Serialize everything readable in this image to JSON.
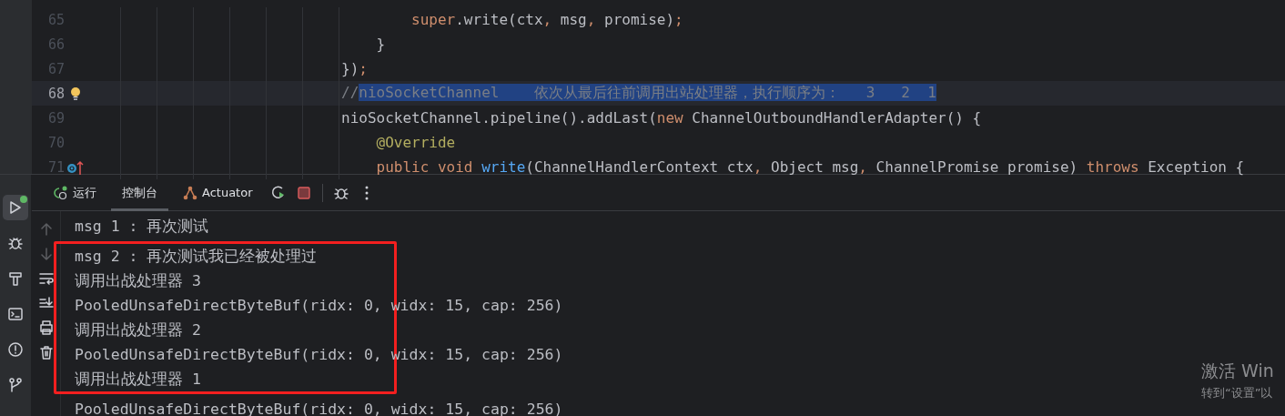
{
  "editor": {
    "lines": [
      {
        "number": "65",
        "current": false,
        "kind": "plain",
        "tokens": [
          {
            "text": "        super",
            "kind": "keyword",
            "selected": false
          },
          {
            "text": ".write(ctx",
            "kind": "plain",
            "selected": false
          },
          {
            "text": ", ",
            "kind": "keyword",
            "selected": false
          },
          {
            "text": "msg",
            "kind": "plain",
            "selected": false
          },
          {
            "text": ", ",
            "kind": "keyword",
            "selected": false
          },
          {
            "text": "promise)",
            "kind": "plain",
            "selected": false
          },
          {
            "text": ";",
            "kind": "keyword",
            "selected": false
          }
        ]
      },
      {
        "number": "66",
        "current": false,
        "kind": "plain",
        "tokens": [
          {
            "text": "    }",
            "kind": "plain",
            "selected": false
          }
        ]
      },
      {
        "number": "67",
        "current": false,
        "kind": "plain",
        "tokens": [
          {
            "text": "})",
            "kind": "plain",
            "selected": false
          },
          {
            "text": ";",
            "kind": "keyword",
            "selected": false
          }
        ]
      },
      {
        "number": "68",
        "current": true,
        "kind": "bulb",
        "tokens": [
          {
            "text": "//",
            "kind": "comment",
            "selected": false
          },
          {
            "text": "nioSocketChannel    依次从最后往前调用出站处理器，执行顺序为：   3   2  1",
            "kind": "comment",
            "selected": true
          }
        ]
      },
      {
        "number": "69",
        "current": false,
        "kind": "plain",
        "tokens": [
          {
            "text": "nioSocketChannel.pipeline().addLast(",
            "kind": "plain",
            "selected": false
          },
          {
            "text": "new ",
            "kind": "keyword",
            "selected": false
          },
          {
            "text": "ChannelOutboundHandlerAdapter() {",
            "kind": "plain",
            "selected": false
          }
        ]
      },
      {
        "number": "70",
        "current": false,
        "kind": "plain",
        "tokens": [
          {
            "text": "    @Override",
            "kind": "annotation",
            "selected": false
          }
        ]
      },
      {
        "number": "71",
        "current": false,
        "kind": "override",
        "tokens": [
          {
            "text": "    public void ",
            "kind": "keyword",
            "selected": false
          },
          {
            "text": "write",
            "kind": "method",
            "selected": false
          },
          {
            "text": "(ChannelHandlerContext ctx",
            "kind": "plain",
            "selected": false
          },
          {
            "text": ", ",
            "kind": "keyword",
            "selected": false
          },
          {
            "text": "Object msg",
            "kind": "plain",
            "selected": false
          },
          {
            "text": ", ",
            "kind": "keyword",
            "selected": false
          },
          {
            "text": "ChannelPromise promise) ",
            "kind": "plain",
            "selected": false
          },
          {
            "text": "throws ",
            "kind": "keyword",
            "selected": false
          },
          {
            "text": "Exception {",
            "kind": "plain",
            "selected": false
          }
        ]
      }
    ]
  },
  "activity_bar": [
    {
      "kind": "run",
      "selected": true
    },
    {
      "kind": "debug",
      "selected": false
    },
    {
      "kind": "build",
      "selected": false
    },
    {
      "kind": "terminal",
      "selected": false
    },
    {
      "kind": "problems",
      "selected": false
    },
    {
      "kind": "git",
      "selected": false
    }
  ],
  "tabs": [
    {
      "label": "运行",
      "kind": "run",
      "selected": false
    },
    {
      "label": "控制台",
      "kind": "plain",
      "selected": true
    },
    {
      "label": "Actuator",
      "kind": "actuator",
      "selected": false
    }
  ],
  "console_tools": [
    {
      "kind": "up",
      "disabled": true
    },
    {
      "kind": "down",
      "disabled": true
    },
    {
      "kind": "wrap",
      "disabled": false
    },
    {
      "kind": "scroll",
      "disabled": false
    },
    {
      "kind": "print",
      "disabled": false
    },
    {
      "kind": "trash",
      "disabled": false
    }
  ],
  "console": {
    "blocks": [
      {
        "framed": false,
        "lines": [
          "msg 1 : 再次测试"
        ]
      },
      {
        "framed": true,
        "lines": [
          "msg 2 : 再次测试我已经被处理过",
          "调用出战处理器 3",
          "PooledUnsafeDirectByteBuf(ridx: 0, widx: 15, cap: 256)",
          "调用出战处理器 2",
          "PooledUnsafeDirectByteBuf(ridx: 0, widx: 15, cap: 256)",
          "调用出战处理器 1"
        ]
      },
      {
        "framed": false,
        "lines": [
          "PooledUnsafeDirectByteBuf(ridx: 0, widx: 15, cap: 256)"
        ]
      }
    ]
  },
  "activation_notice": {
    "title": "激活 Win",
    "subtitle": "转到“设置”以"
  }
}
